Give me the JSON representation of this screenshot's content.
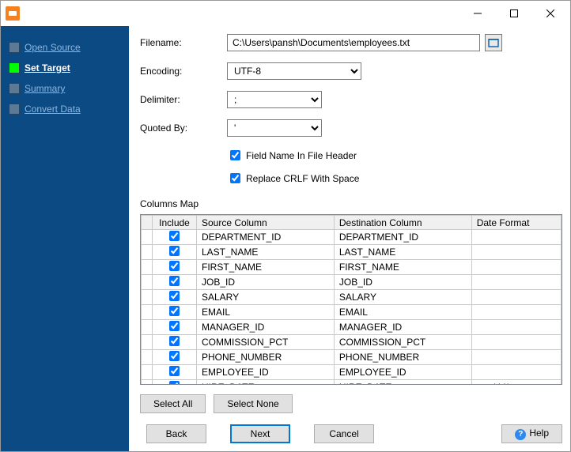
{
  "window": {
    "min_tooltip": "Minimize",
    "max_tooltip": "Maximize",
    "close_tooltip": "Close"
  },
  "sidebar": {
    "steps": [
      {
        "label": "Open Source",
        "active": false
      },
      {
        "label": "Set Target",
        "active": true
      },
      {
        "label": "Summary",
        "active": false
      },
      {
        "label": "Convert Data",
        "active": false
      }
    ]
  },
  "form": {
    "filename_label": "Filename:",
    "filename_value": "C:\\Users\\pansh\\Documents\\employees.txt",
    "encoding_label": "Encoding:",
    "encoding_value": "UTF-8",
    "delimiter_label": "Delimiter:",
    "delimiter_value": ";",
    "quoted_label": "Quoted By:",
    "quoted_value": "'",
    "field_header_check": "Field Name In File Header",
    "field_header_on": true,
    "replace_crlf_check": "Replace CRLF With Space",
    "replace_crlf_on": true,
    "columns_map_label": "Columns Map"
  },
  "columns": {
    "headers": {
      "include": "Include",
      "source": "Source Column",
      "dest": "Destination Column",
      "fmt": "Date Format"
    },
    "rows": [
      {
        "include": true,
        "source": "DEPARTMENT_ID",
        "dest": "DEPARTMENT_ID",
        "fmt": ""
      },
      {
        "include": true,
        "source": "LAST_NAME",
        "dest": "LAST_NAME",
        "fmt": ""
      },
      {
        "include": true,
        "source": "FIRST_NAME",
        "dest": "FIRST_NAME",
        "fmt": ""
      },
      {
        "include": true,
        "source": "JOB_ID",
        "dest": "JOB_ID",
        "fmt": ""
      },
      {
        "include": true,
        "source": "SALARY",
        "dest": "SALARY",
        "fmt": ""
      },
      {
        "include": true,
        "source": "EMAIL",
        "dest": "EMAIL",
        "fmt": ""
      },
      {
        "include": true,
        "source": "MANAGER_ID",
        "dest": "MANAGER_ID",
        "fmt": ""
      },
      {
        "include": true,
        "source": "COMMISSION_PCT",
        "dest": "COMMISSION_PCT",
        "fmt": ""
      },
      {
        "include": true,
        "source": "PHONE_NUMBER",
        "dest": "PHONE_NUMBER",
        "fmt": ""
      },
      {
        "include": true,
        "source": "EMPLOYEE_ID",
        "dest": "EMPLOYEE_ID",
        "fmt": ""
      },
      {
        "include": true,
        "source": "HIRE_DATE",
        "dest": "HIRE_DATE",
        "fmt": "mm/dd/yyyy"
      }
    ]
  },
  "buttons": {
    "select_all": "Select All",
    "select_none": "Select None",
    "back": "Back",
    "next": "Next",
    "cancel": "Cancel",
    "help": "Help"
  }
}
